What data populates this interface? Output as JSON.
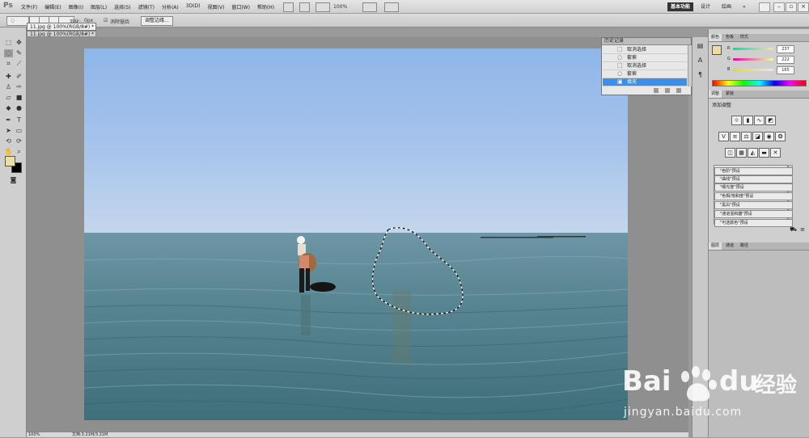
{
  "app": {
    "logo": "Ps",
    "menus": [
      "文件(F)",
      "编辑(E)",
      "图像(I)",
      "图层(L)",
      "选择(S)",
      "滤镜(T)",
      "分析(A)",
      "3D(D)",
      "视图(V)",
      "窗口(W)",
      "帮助(H)"
    ],
    "zoom": "100%",
    "workspaces": [
      "基本功能",
      "设计",
      "绘画"
    ],
    "workspace_more": "»"
  },
  "options": {
    "feather_label": "羽化:",
    "feather_value": "0px",
    "antialias_label": "消除锯齿",
    "refine_edge_button": "调整边缘..."
  },
  "document": {
    "tab_title": "11.jpg @ 100%(RGB/8#) *",
    "tab_title_2": "11.jpg @ 100%(RGB/8#) *"
  },
  "status": {
    "zoom": "100%",
    "doc_info": "文档:3.21M/3.21M"
  },
  "history": {
    "title": "历史记录",
    "items": [
      {
        "icon": "dotted-rect-icon",
        "label": "取消选择"
      },
      {
        "icon": "lasso-icon",
        "label": "套索"
      },
      {
        "icon": "dotted-rect-icon",
        "label": "取消选择"
      },
      {
        "icon": "lasso-icon",
        "label": "套索"
      },
      {
        "icon": "fill-icon",
        "label": "填充"
      }
    ],
    "selected_index": 4
  },
  "color_panel": {
    "tabs": [
      "颜色",
      "色板",
      "样式"
    ],
    "r_label": "R",
    "r_value": "237",
    "g_label": "G",
    "g_value": "222",
    "b_label": "B",
    "b_value": "165",
    "foreground": "#EDDEA5"
  },
  "adjust_panel": {
    "tabs": [
      "调整",
      "蒙版"
    ],
    "title": "添加调整",
    "presets": [
      "\"色阶\"预设",
      "\"曲线\"预设",
      "\"曝光度\"预设",
      "\"色相/饱和度\"预设",
      "\"黑白\"预设",
      "\"通道混和器\"预设",
      "\"可选颜色\"预设"
    ]
  },
  "layers_panel": {
    "tabs": [
      "图层",
      "通道",
      "路径"
    ]
  },
  "watermark": {
    "brand": "Bai",
    "brand2": "du",
    "cn": "经验",
    "url": "jingyan.baidu.com"
  },
  "colors": {
    "accent_selected": "#3B8FE8",
    "foreground_swatch": "#EDDEA5",
    "background_swatch": "#000000"
  }
}
